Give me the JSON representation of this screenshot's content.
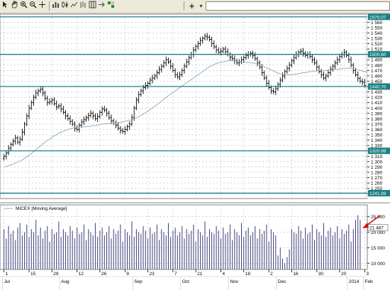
{
  "toolbar": {
    "left_icons": [
      "select-icon",
      "hand-icon",
      "zoom-in-icon",
      "zoom-out-icon",
      "crosshair-icon",
      "bar-chart-icon",
      "candlestick-icon",
      "line-chart-icon",
      "ohlc-icon",
      "grid-icon",
      "auto-scroll-icon",
      "indicator-icon"
    ],
    "crosshair_label": "+"
  },
  "colors": {
    "grid": "#b8b8b8",
    "level_line": "#1a7f82",
    "price_bar": "#000000",
    "moving_average": "#8fb0c8",
    "volume_bar": "#3c3c7a",
    "arrow": "#d01010",
    "label_box": "#1a7f82"
  },
  "chart_data": [
    {
      "type": "ohlc",
      "instrument": "MICEX",
      "ylim": [
        1231,
        1575
      ],
      "y_ticks": [
        "1 560",
        "1 550",
        "1 540",
        "1 530",
        "1 520",
        "1 510",
        "1 500",
        "1 490",
        "1 480",
        "1 470",
        "1 460",
        "1 450",
        "1 440",
        "1 430",
        "1 420",
        "1 410",
        "1 400",
        "1 390",
        "1 380",
        "1 370",
        "1 360",
        "1 350",
        "1 340",
        "1 330",
        "1 320",
        "1 310",
        "1 300",
        "1 290",
        "1 280",
        "1 270",
        "1 260",
        "1 250",
        "1 240"
      ],
      "horizontal_levels": [
        {
          "value": 1570,
          "label": "1570.07"
        },
        {
          "value": 1500,
          "label": "1500.60"
        },
        {
          "value": 1440,
          "label": "1440.70"
        },
        {
          "value": 1320,
          "label": "1320.99"
        },
        {
          "value": 1241,
          "label": "1241.99"
        }
      ],
      "close": [
        1310,
        1316,
        1325,
        1332,
        1338,
        1344,
        1336,
        1342,
        1355,
        1370,
        1385,
        1400,
        1410,
        1420,
        1428,
        1432,
        1435,
        1428,
        1418,
        1410,
        1412,
        1415,
        1408,
        1402,
        1404,
        1398,
        1392,
        1385,
        1380,
        1375,
        1370,
        1362,
        1360,
        1368,
        1374,
        1378,
        1382,
        1386,
        1390,
        1385,
        1380,
        1384,
        1392,
        1398,
        1396,
        1390,
        1382,
        1376,
        1372,
        1368,
        1362,
        1358,
        1356,
        1360,
        1365,
        1370,
        1382,
        1400,
        1415,
        1425,
        1432,
        1438,
        1442,
        1446,
        1452,
        1456,
        1460,
        1466,
        1472,
        1478,
        1484,
        1490,
        1486,
        1478,
        1470,
        1462,
        1458,
        1462,
        1470,
        1478,
        1486,
        1494,
        1500,
        1508,
        1515,
        1520,
        1526,
        1530,
        1534,
        1532,
        1528,
        1520,
        1514,
        1508,
        1504,
        1506,
        1510,
        1505,
        1500,
        1495,
        1492,
        1488,
        1484,
        1486,
        1490,
        1494,
        1498,
        1500,
        1502,
        1498,
        1492,
        1484,
        1476,
        1466,
        1456,
        1446,
        1438,
        1432,
        1430,
        1436,
        1444,
        1452,
        1460,
        1468,
        1474,
        1480,
        1488,
        1494,
        1500,
        1504,
        1506,
        1502,
        1498,
        1500,
        1496,
        1490,
        1484,
        1476,
        1468,
        1462,
        1456,
        1460,
        1466,
        1472,
        1478,
        1484,
        1490,
        1496,
        1500,
        1504,
        1498,
        1490,
        1480,
        1470,
        1462,
        1455,
        1450,
        1448,
        1442
      ],
      "moving_average": [
        1290,
        1291,
        1292,
        1294,
        1295,
        1297,
        1299,
        1301,
        1303,
        1306,
        1309,
        1312,
        1315,
        1319,
        1322,
        1326,
        1329,
        1333,
        1336,
        1339,
        1342,
        1345,
        1348,
        1350,
        1353,
        1355,
        1357,
        1358,
        1360,
        1361,
        1362,
        1363,
        1363,
        1364,
        1364,
        1365,
        1365,
        1366,
        1366,
        1367,
        1367,
        1368,
        1369,
        1370,
        1370,
        1371,
        1371,
        1372,
        1372,
        1372,
        1373,
        1373,
        1374,
        1375,
        1376,
        1377,
        1378,
        1380,
        1382,
        1384,
        1386,
        1389,
        1391,
        1394,
        1397,
        1400,
        1403,
        1406,
        1409,
        1413,
        1416,
        1420,
        1423,
        1426,
        1429,
        1432,
        1435,
        1438,
        1441,
        1444,
        1447,
        1450,
        1453,
        1456,
        1459,
        1462,
        1465,
        1468,
        1471,
        1474,
        1477,
        1479,
        1481,
        1483,
        1484,
        1485,
        1486,
        1487,
        1488,
        1488,
        1488,
        1488,
        1487,
        1487,
        1486,
        1486,
        1485,
        1485,
        1484,
        1484,
        1483,
        1482,
        1481,
        1479,
        1477,
        1475,
        1473,
        1471,
        1469,
        1467,
        1465,
        1464,
        1463,
        1462,
        1462,
        1462,
        1462,
        1463,
        1463,
        1464,
        1465,
        1466,
        1466,
        1467,
        1468,
        1468,
        1469,
        1469,
        1470,
        1470,
        1470,
        1470,
        1471,
        1471,
        1471,
        1472,
        1472,
        1473,
        1473,
        1474,
        1474,
        1474,
        1474,
        1473,
        1472,
        1471,
        1470,
        1469,
        1468,
        1467
      ]
    },
    {
      "type": "bar",
      "legend": "MICEX [Moving Average]",
      "ylim": [
        8000,
        27000
      ],
      "y_ticks": [
        "25 000",
        "20 000",
        "15 000",
        "10 000"
      ],
      "last_value_label": "21 487",
      "volume": [
        21000,
        18000,
        22000,
        19500,
        20500,
        17500,
        21500,
        23000,
        19000,
        20000,
        22500,
        18500,
        21000,
        20000,
        24000,
        19000,
        21500,
        18000,
        20500,
        22000,
        17000,
        21000,
        19500,
        20000,
        23500,
        18500,
        21000,
        20000,
        19000,
        22000,
        20500,
        18000,
        21500,
        19500,
        20000,
        22500,
        17500,
        21000,
        20000,
        19000,
        23000,
        18500,
        20500,
        21500,
        19000,
        20000,
        22000,
        18000,
        21000,
        19500,
        20500,
        22500,
        17000,
        21000,
        20000,
        19000,
        23500,
        18500,
        21000,
        20000,
        19500,
        22000,
        20500,
        18000,
        21500,
        19500,
        20000,
        22500,
        17500,
        21000,
        20000,
        19000,
        23000,
        18500,
        20500,
        21500,
        19000,
        20000,
        22000,
        18000,
        21000,
        19500,
        20500,
        22500,
        17000,
        21000,
        20000,
        19000,
        23500,
        18500,
        21000,
        20000,
        19500,
        22000,
        20500,
        18000,
        21500,
        19500,
        20000,
        22500,
        17500,
        21000,
        20000,
        19000,
        23000,
        18500,
        20500,
        21500,
        19000,
        20000,
        22000,
        18000,
        21000,
        19500,
        20500,
        22500,
        17000,
        21000,
        20000,
        19000,
        12500,
        15000,
        11500,
        10000,
        12000,
        14500,
        21000,
        20000,
        19500,
        22000,
        20500,
        18000,
        21500,
        19500,
        20000,
        22500,
        17500,
        21000,
        20000,
        19000,
        23000,
        18500,
        20500,
        21500,
        19000,
        20000,
        22000,
        18000,
        21000,
        19500,
        20500,
        22500,
        17000,
        21000,
        24000,
        25500,
        24000
      ]
    }
  ],
  "x_axis": {
    "day_labels": [
      "1",
      "15",
      "29",
      "12",
      "26",
      "9",
      "23",
      "7",
      "21",
      "4",
      "18",
      "2",
      "16",
      "30",
      "20",
      "3"
    ],
    "month_labels": [
      "Jul",
      "Aug",
      "Sep",
      "Oct",
      "Nov",
      "Dec",
      "2014",
      "Feb"
    ]
  }
}
